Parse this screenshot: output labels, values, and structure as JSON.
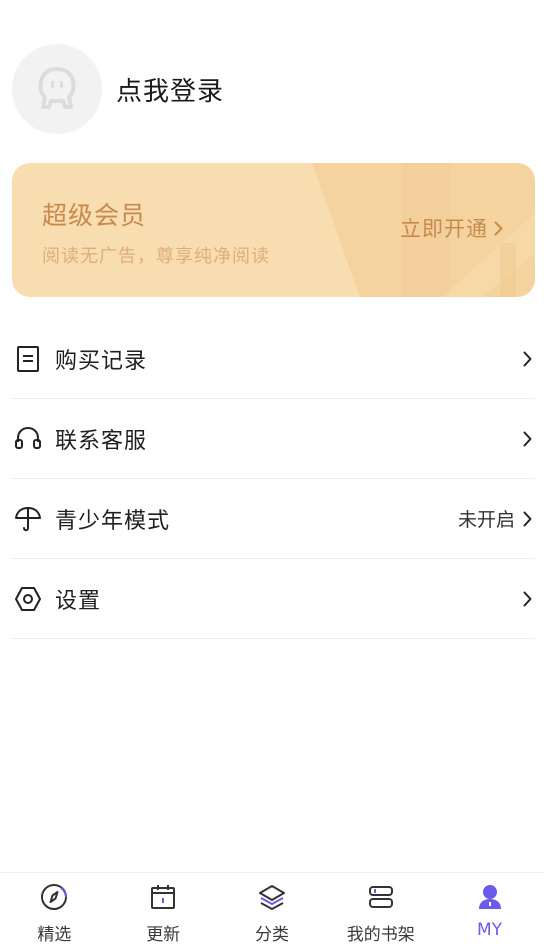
{
  "profile": {
    "login_label": "点我登录"
  },
  "vip": {
    "title": "超级会员",
    "subtitle": "阅读无广告，尊享纯净阅读",
    "cta": "立即开通"
  },
  "menu": [
    {
      "label": "购买记录",
      "icon": "receipt-icon",
      "value": ""
    },
    {
      "label": "联系客服",
      "icon": "headset-icon",
      "value": ""
    },
    {
      "label": "青少年模式",
      "icon": "umbrella-icon",
      "value": "未开启"
    },
    {
      "label": "设置",
      "icon": "gear-hexagon-icon",
      "value": ""
    }
  ],
  "tabbar": {
    "items": [
      {
        "label": "精选",
        "icon": "compass-icon"
      },
      {
        "label": "更新",
        "icon": "calendar-icon"
      },
      {
        "label": "分类",
        "icon": "layers-icon"
      },
      {
        "label": "我的书架",
        "icon": "bookshelf-icon"
      },
      {
        "label": "MY",
        "icon": "user-icon"
      }
    ],
    "active_index": 4
  },
  "colors": {
    "accent": "#6b5ce7",
    "vip_bg": "#f7ddb0",
    "vip_text": "#c9894d"
  }
}
